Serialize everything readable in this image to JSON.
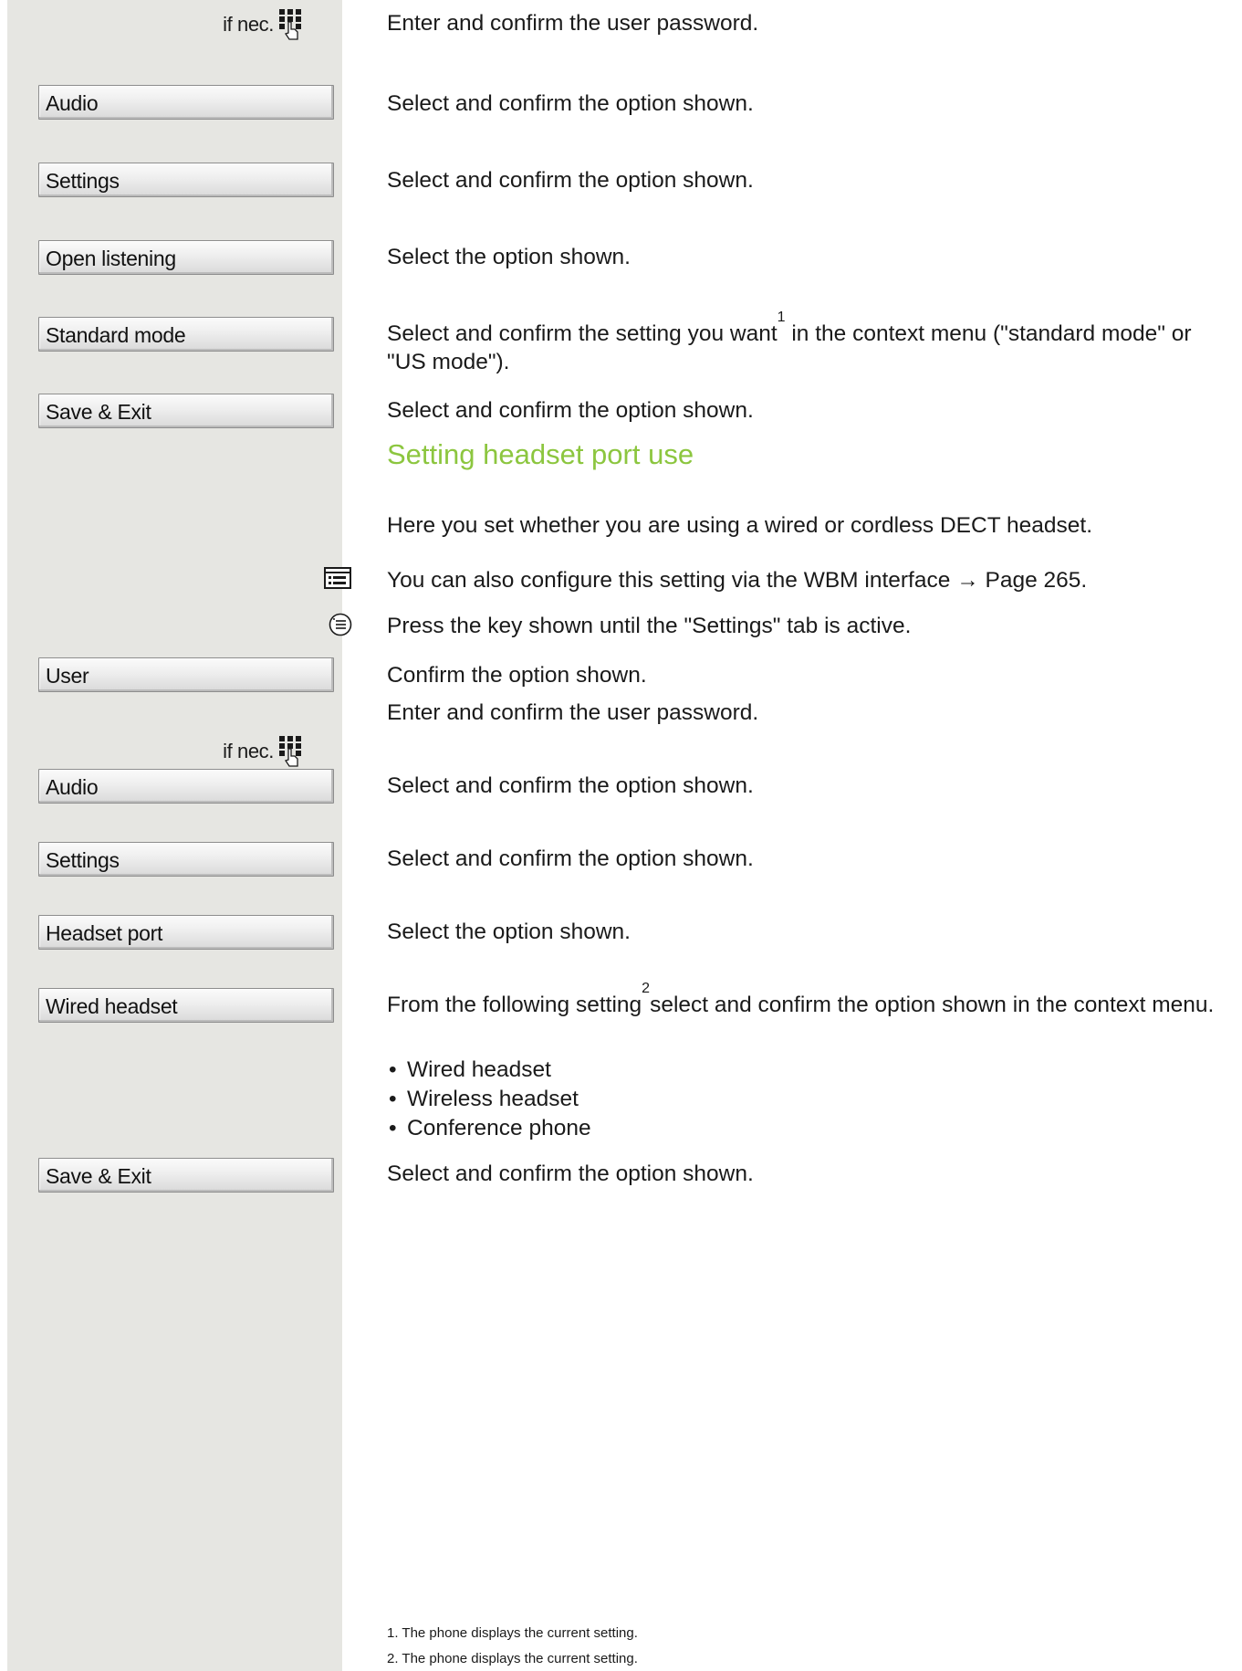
{
  "sidebar": {
    "if_nec_1": "if nec.",
    "if_nec_2": "if nec.",
    "buttons": [
      "Audio",
      "Settings",
      "Open listening",
      "Standard mode",
      "Save & Exit",
      "User",
      "Audio",
      "Settings",
      "Headset port",
      "Wired headset",
      "Save & Exit"
    ]
  },
  "steps": {
    "s1": "Enter and confirm the user password.",
    "s2": "Select and confirm the option shown.",
    "s3": "Select and confirm the option shown.",
    "s4": "Select the option shown.",
    "s5_a": "Select and confirm the setting you want",
    "s5_sup": "1",
    "s5_b": " in the context menu (\"standard mode\" or \"US mode\").",
    "s6": "Select and confirm the option shown.",
    "heading": "Setting headset port use",
    "intro": "Here you set whether you are using a wired or cordless DECT headset.",
    "wbm_a": "You can also configure this setting via the WBM interface",
    "wbm_arrow": "→",
    "wbm_b": "Page 265.",
    "press": "Press the key shown until the \"Settings\" tab is active.",
    "confirm": "Confirm the option shown.",
    "s7": "Enter and confirm the user password.",
    "s8": "Select and confirm the option shown.",
    "s9": "Select and confirm the option shown.",
    "s10": "Select the option shown.",
    "s11_a": "From the following setting",
    "s11_sup": "2",
    "s11_b": "select and confirm the option shown in the context menu.",
    "bullets": [
      "Wired headset",
      "Wireless headset",
      "Conference phone"
    ],
    "s12": "Select and confirm the option shown."
  },
  "footnotes": {
    "f1": "1.  The phone displays the current setting.",
    "f2": "2.  The phone displays the current setting."
  }
}
